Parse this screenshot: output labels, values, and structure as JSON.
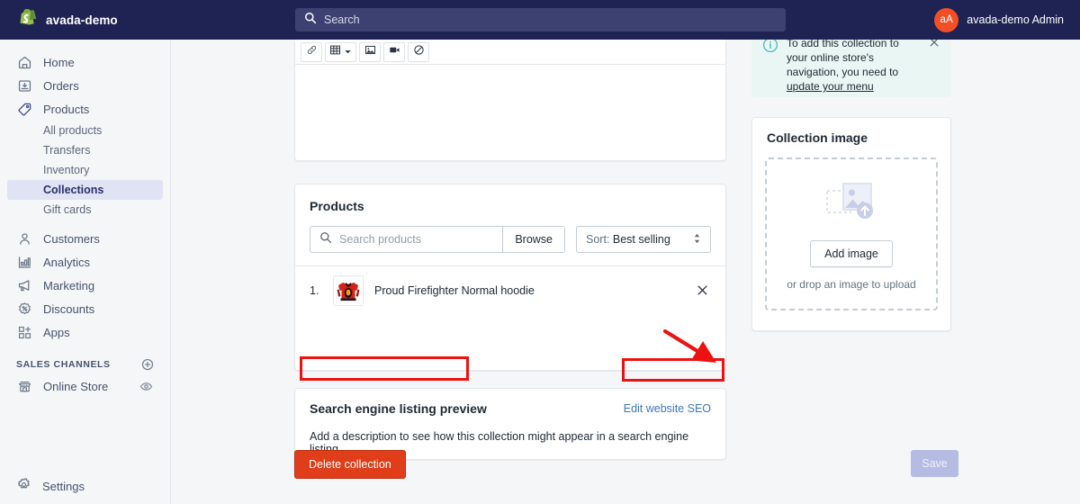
{
  "topbar": {
    "store_name": "avada-demo",
    "logo_icon": "shopify-bag-icon",
    "search_icon": "search-icon",
    "search_placeholder": "Search",
    "search_value": "",
    "avatar_initials": "aA",
    "avatar_color": "#f24f26",
    "user_name": "avada-demo Admin",
    "background_color": "#1f2353"
  },
  "sidebar": {
    "items": [
      {
        "label": "Home",
        "icon": "home-icon"
      },
      {
        "label": "Orders",
        "icon": "orders-inbox-icon"
      },
      {
        "label": "Products",
        "icon": "products-tag-icon"
      }
    ],
    "product_subitems": [
      {
        "label": "All products",
        "active": false
      },
      {
        "label": "Transfers",
        "active": false
      },
      {
        "label": "Inventory",
        "active": false
      },
      {
        "label": "Collections",
        "active": true
      },
      {
        "label": "Gift cards",
        "active": false
      }
    ],
    "items_lower": [
      {
        "label": "Customers",
        "icon": "customers-person-icon"
      },
      {
        "label": "Analytics",
        "icon": "analytics-bars-icon"
      },
      {
        "label": "Marketing",
        "icon": "marketing-megaphone-icon"
      },
      {
        "label": "Discounts",
        "icon": "discounts-percent-badge-icon"
      },
      {
        "label": "Apps",
        "icon": "apps-grid-plus-icon"
      }
    ],
    "sales_channels": {
      "heading": "SALES CHANNELS",
      "add_icon": "plus-circle-icon",
      "channels": [
        {
          "label": "Online Store",
          "icon": "storefront-icon",
          "action_icon": "eye-icon"
        }
      ]
    },
    "settings": {
      "label": "Settings",
      "icon": "gear-icon"
    },
    "active_color": "#2b2f6b",
    "active_background": "#dfe3f3"
  },
  "editor": {
    "toolbar_buttons": [
      {
        "icon": "link-icon",
        "name": "insert-link"
      },
      {
        "icon": "table-icon",
        "name": "insert-table",
        "has_caret": true
      },
      {
        "icon": "image-icon",
        "name": "insert-image"
      },
      {
        "icon": "video-icon",
        "name": "insert-video"
      },
      {
        "icon": "clear-formatting-icon",
        "name": "clear-formatting"
      }
    ],
    "content": ""
  },
  "products_card": {
    "title": "Products",
    "search_icon": "search-icon",
    "search_placeholder": "Search products",
    "search_value": "",
    "browse_label": "Browse",
    "sort": {
      "prefix": "Sort:",
      "value": "Best selling",
      "caret_icon": "updown-chevrons-icon"
    },
    "rows": [
      {
        "number": "1.",
        "thumbnail": "red-hoodie-thumbnail",
        "name": "Proud Firefighter Normal hoodie",
        "remove_icon": "close-x-icon"
      }
    ]
  },
  "seo_card": {
    "title": "Search engine listing preview",
    "edit_link": "Edit website SEO",
    "edit_link_color": "#3f76bd",
    "description": "Add a description to see how this collection might appear in a search engine listing"
  },
  "banner": {
    "info_icon": "info-circle-icon",
    "text_before_link": "To add this collection to your online store's navigation, you need to ",
    "link_text": "update your menu",
    "close_icon": "close-x-icon",
    "background_color": "#eaf6f3"
  },
  "image_card": {
    "title": "Collection image",
    "upload_icon": "image-upload-placeholder-icon",
    "add_button": "Add image",
    "drop_hint": "or drop an image to upload"
  },
  "footer": {
    "delete_label": "Delete collection",
    "delete_color": "#e03e1a",
    "save_label": "Save",
    "save_disabled": true,
    "save_color": "#b5bbe3"
  },
  "annotations": {
    "highlight_color": "#ee1111",
    "boxes": [
      {
        "name": "seo-title-highlight"
      },
      {
        "name": "edit-seo-link-highlight"
      }
    ],
    "arrow": {
      "name": "pointer-arrow",
      "points_to": "Edit website SEO"
    }
  }
}
